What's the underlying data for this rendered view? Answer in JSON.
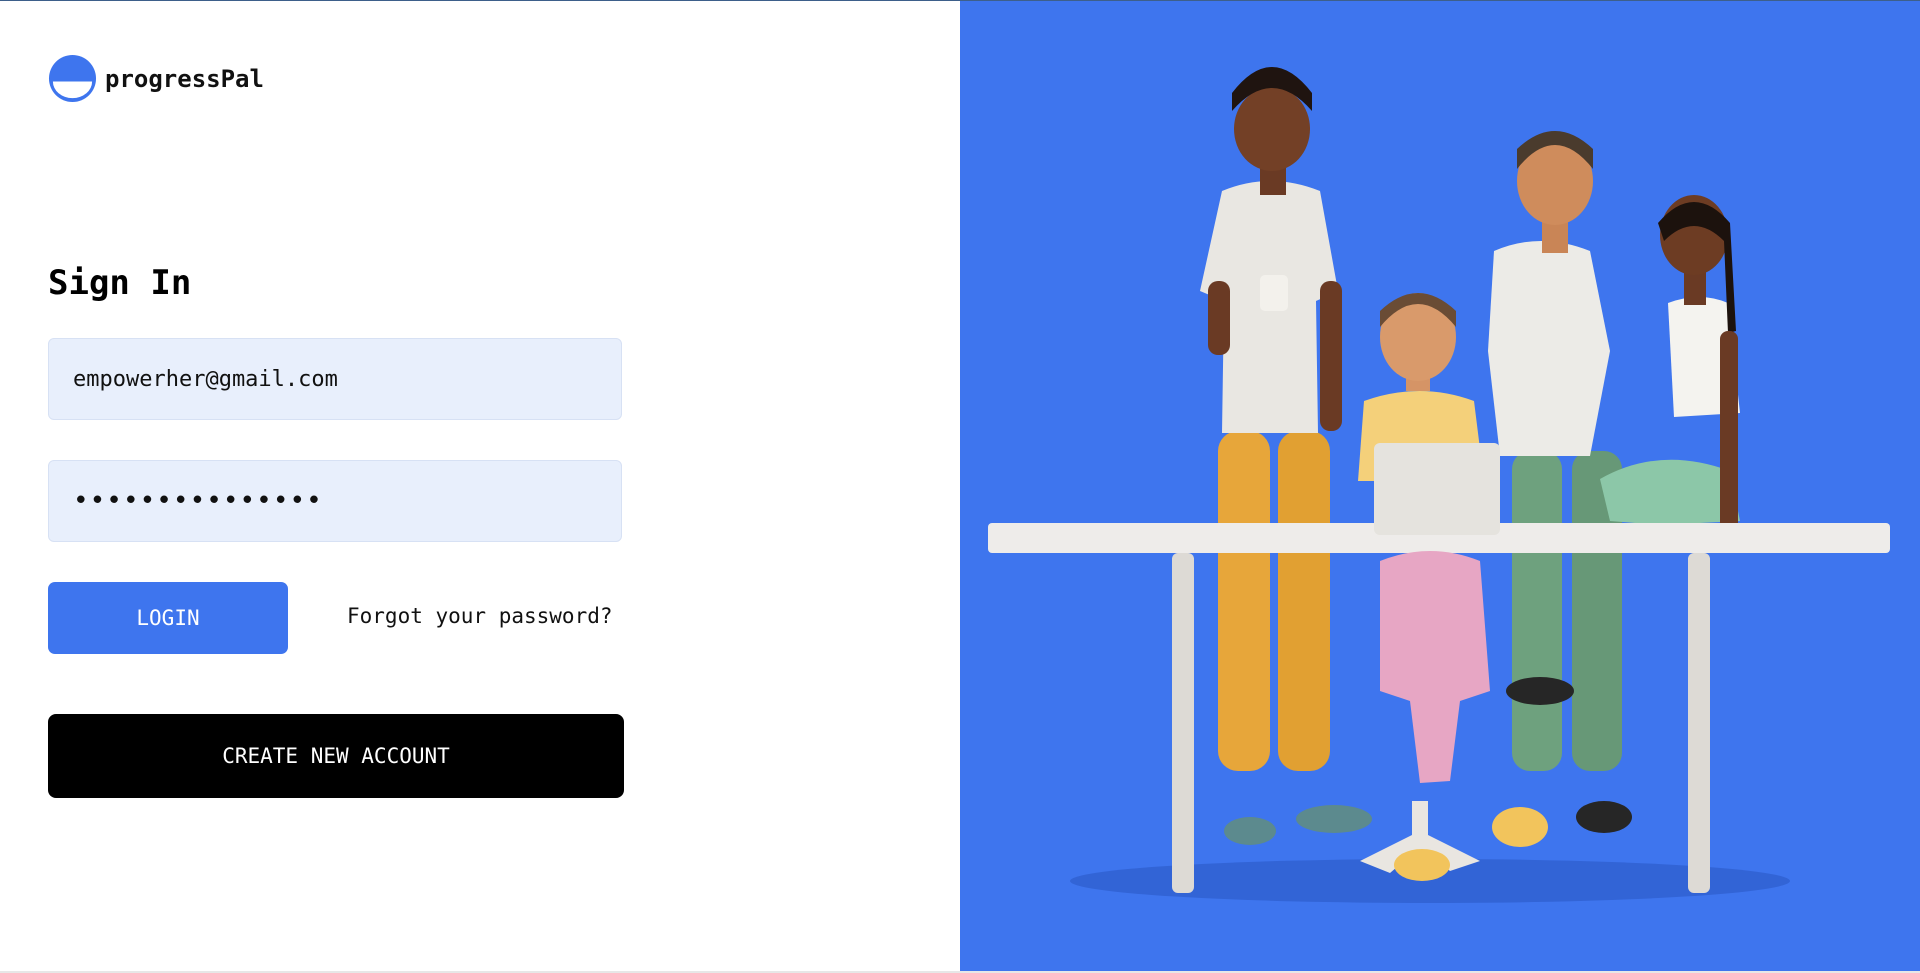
{
  "brand": {
    "name": "progressPal",
    "logo_icon": "half-circle-logo-icon",
    "accent": "#3e75ee"
  },
  "signin": {
    "title": "Sign In",
    "email_value": "empowerher@gmail.com",
    "password_value": "•••••••••••••••",
    "login_label": "LOGIN",
    "forgot_label": "Forgot your password?",
    "create_label": "CREATE NEW ACCOUNT"
  },
  "hero": {
    "background": "#3e75ee",
    "illustration": "team-of-four-people-at-desk-illustration"
  }
}
